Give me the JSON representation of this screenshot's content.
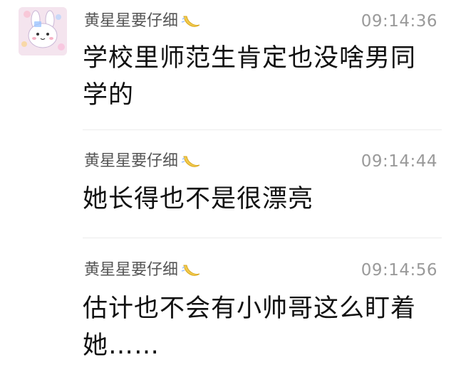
{
  "messages": [
    {
      "sender": "黄星星要仔细",
      "time": "09:14:36",
      "text": "学校里师范生肯定也没啥男同学的"
    },
    {
      "sender": "黄星星要仔细",
      "time": "09:14:44",
      "text": "她长得也不是很漂亮"
    },
    {
      "sender": "黄星星要仔细",
      "time": "09:14:56",
      "text": "估计也不会有小帅哥这么盯着她……"
    }
  ],
  "icons": {
    "sender_emoji": "crescent-moon-icon",
    "avatar": "cartoon-bunny-avatar"
  },
  "colors": {
    "sender_name": "#555555",
    "timestamp": "#9a9a9a",
    "message_text": "#111111",
    "moon": "#f2c94c"
  }
}
